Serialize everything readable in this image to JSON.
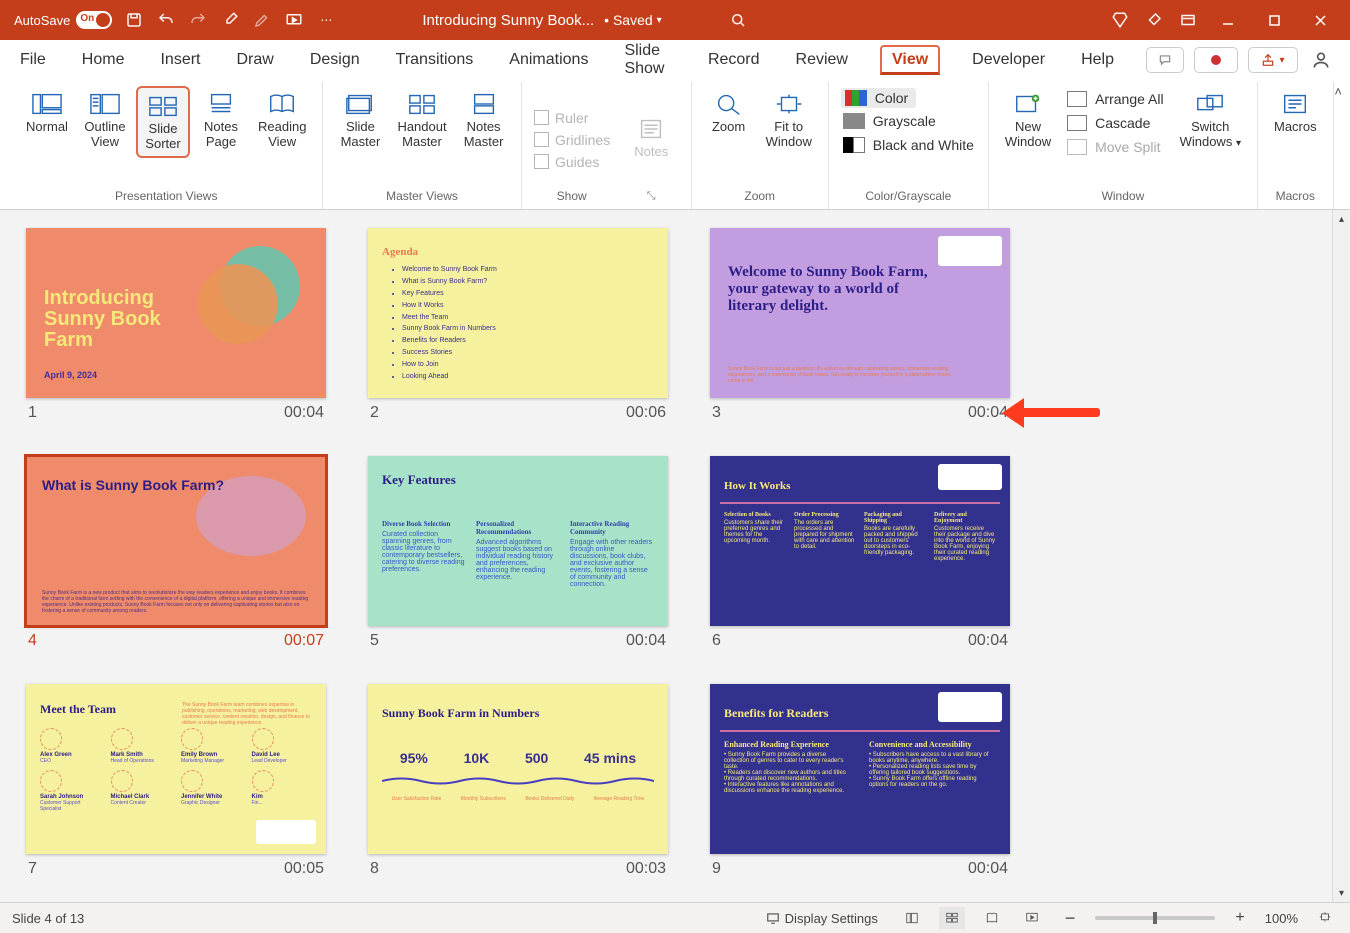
{
  "titlebar": {
    "autosave_label": "AutoSave",
    "autosave_state": "On",
    "doc_name": "Introducing Sunny Book...",
    "saved_label": "• Saved"
  },
  "tabs": {
    "file": "File",
    "home": "Home",
    "insert": "Insert",
    "draw": "Draw",
    "design": "Design",
    "transitions": "Transitions",
    "animations": "Animations",
    "slideshow": "Slide Show",
    "record": "Record",
    "review": "Review",
    "view": "View",
    "developer": "Developer",
    "help": "Help"
  },
  "ribbon": {
    "presentation_views": {
      "label": "Presentation Views",
      "normal": "Normal",
      "outline": "Outline\nView",
      "sorter": "Slide\nSorter",
      "notes": "Notes\nPage",
      "reading": "Reading\nView"
    },
    "master_views": {
      "label": "Master Views",
      "slide": "Slide\nMaster",
      "handout": "Handout\nMaster",
      "notes": "Notes\nMaster"
    },
    "show": {
      "label": "Show",
      "ruler": "Ruler",
      "gridlines": "Gridlines",
      "guides": "Guides",
      "notes": "Notes"
    },
    "zoom": {
      "label": "Zoom",
      "zoom": "Zoom",
      "fit": "Fit to\nWindow"
    },
    "color": {
      "label": "Color/Grayscale",
      "color": "Color",
      "grayscale": "Grayscale",
      "bw": "Black and White"
    },
    "window": {
      "label": "Window",
      "new": "New\nWindow",
      "arrange": "Arrange All",
      "cascade": "Cascade",
      "split": "Move Split",
      "switch": "Switch\nWindows"
    },
    "macros": {
      "label": "Macros",
      "macros": "Macros"
    }
  },
  "slides": [
    {
      "num": "1",
      "time": "00:04",
      "title_lines": [
        "Introducing",
        "Sunny Book",
        "Farm"
      ],
      "date": "April 9, 2024"
    },
    {
      "num": "2",
      "time": "00:06",
      "heading": "Agenda",
      "items": [
        "Welcome to Sunny Book Farm",
        "What is Sunny Book Farm?",
        "Key Features",
        "How It Works",
        "Meet the Team",
        "Sunny Book Farm in Numbers",
        "Benefits for Readers",
        "Success Stories",
        "How to Join",
        "Looking Ahead"
      ]
    },
    {
      "num": "3",
      "time": "00:04",
      "heading": "Welcome to Sunny Book Farm, your gateway to a world of literary delight.",
      "para": "Sunny Book Farm is not just a platform; it's a journey through captivating stories, immersive reading experiences, and a community of book lovers. Get ready to immerse yourself in a place where books come to life."
    },
    {
      "num": "4",
      "time": "00:07",
      "heading": "What is Sunny Book Farm?",
      "para": "Sunny Book Farm is a new product that aims to revolutionize the way readers experience and enjoy books. It combines the charm of a traditional farm setting with the convenience of a digital platform, offering a unique and immersive reading experience. Unlike existing products, Sunny Book Farm focuses not only on delivering captivating stories but also on fostering a sense of community among readers."
    },
    {
      "num": "5",
      "time": "00:04",
      "heading": "Key Features",
      "cols": [
        {
          "h": "Diverse Book Selection",
          "p": "Curated collection spanning genres, from classic literature to contemporary bestsellers, catering to diverse reading preferences."
        },
        {
          "h": "Personalized Recommendations",
          "p": "Advanced algorithms suggest books based on individual reading history and preferences, enhancing the reading experience."
        },
        {
          "h": "Interactive Reading Community",
          "p": "Engage with other readers through online discussions, book clubs, and exclusive author events, fostering a sense of community and connection."
        }
      ]
    },
    {
      "num": "6",
      "time": "00:04",
      "heading": "How It Works",
      "cols": [
        {
          "h": "Selection of Books",
          "p": "Customers share their preferred genres and themes for the upcoming month."
        },
        {
          "h": "Order Processing",
          "p": "The orders are processed and prepared for shipment with care and attention to detail."
        },
        {
          "h": "Packaging and Shipping",
          "p": "Books are carefully packed and shipped out to customers' doorsteps in eco-friendly packaging."
        },
        {
          "h": "Delivery and Enjoyment",
          "p": "Customers receive their package and dive into the world of Sunny Book Farm, enjoying their curated reading experience."
        }
      ]
    },
    {
      "num": "7",
      "time": "00:05",
      "heading": "Meet the Team",
      "side": "The Sunny Book Farm team combines expertise in publishing, operations, marketing, web development, customer service, content creation, design, and finance to deliver a unique reading experience.",
      "members": [
        {
          "n": "Alex Green",
          "r": "CEO"
        },
        {
          "n": "Mark Smith",
          "r": "Head of Operations"
        },
        {
          "n": "Emily Brown",
          "r": "Marketing Manager"
        },
        {
          "n": "David Lee",
          "r": "Lead Developer"
        },
        {
          "n": "Sarah Johnson",
          "r": "Customer Support Specialist"
        },
        {
          "n": "Michael Clark",
          "r": "Content Creator"
        },
        {
          "n": "Jennifer White",
          "r": "Graphic Designer"
        },
        {
          "n": "Kim",
          "r": "Fin..."
        }
      ]
    },
    {
      "num": "8",
      "time": "00:03",
      "heading": "Sunny Book Farm in Numbers",
      "stats": [
        {
          "v": "95%",
          "c": "User Satisfaction Rate"
        },
        {
          "v": "10K",
          "c": "Monthly Subscribers"
        },
        {
          "v": "500",
          "c": "Books Delivered Daily"
        },
        {
          "v": "45 mins",
          "c": "Average Reading Time"
        }
      ]
    },
    {
      "num": "9",
      "time": "00:04",
      "heading": "Benefits for Readers",
      "cols": [
        {
          "h": "Enhanced Reading Experience",
          "items": [
            "Sunny Book Farm provides a diverse collection of genres to cater to every reader's taste.",
            "Readers can discover new authors and titles through curated recommendations.",
            "Interactive features like annotations and discussions enhance the reading experience."
          ]
        },
        {
          "h": "Convenience and Accessibility",
          "items": [
            "Subscribers have access to a vast library of books anytime, anywhere.",
            "Personalized reading lists save time by offering tailored book suggestions.",
            "Sunny Book Farm offers offline reading options for readers on the go."
          ]
        }
      ]
    }
  ],
  "status": {
    "slide_of": "Slide 4 of 13",
    "display": "Display Settings",
    "zoom": "100%"
  }
}
